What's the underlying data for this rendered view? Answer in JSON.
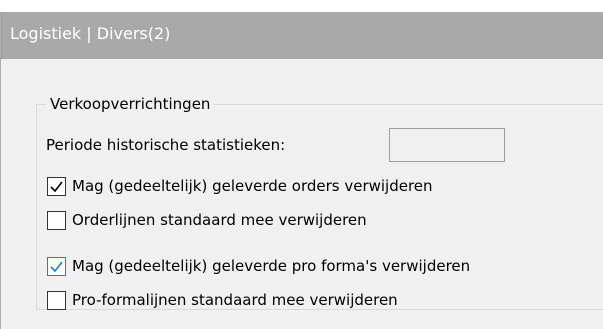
{
  "panel": {
    "title": "Logistiek | Divers(2)"
  },
  "group": {
    "legend": "Verkoopverrichtingen",
    "period_label": "Periode historische statistieken:",
    "period_value": "",
    "options": [
      {
        "label": "Mag (gedeeltelijk) geleverde orders verwijderen",
        "checked": true
      },
      {
        "label": "Orderlijnen standaard mee verwijderen",
        "checked": false
      },
      {
        "label": "Mag (gedeeltelijk) geleverde pro forma's verwijderen",
        "checked": true
      },
      {
        "label": "Pro-formalijnen standaard mee verwijderen",
        "checked": false
      }
    ]
  },
  "colors": {
    "header_bg": "#a9a9a9",
    "panel_bg": "#f0f0f0",
    "check_focus": "#1c7ce0"
  }
}
